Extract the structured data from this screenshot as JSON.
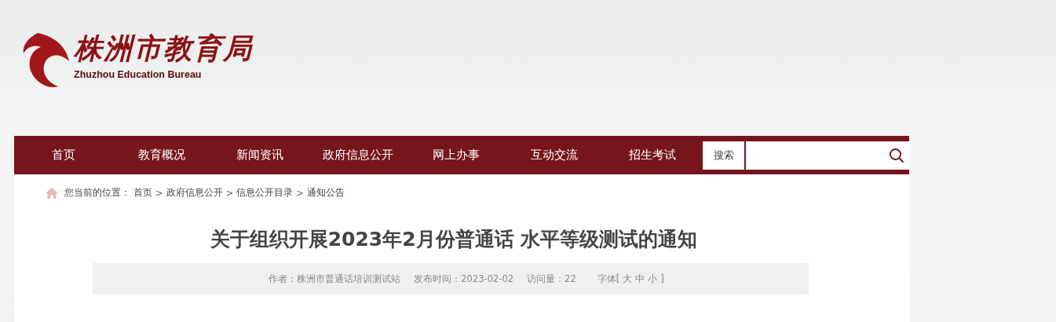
{
  "site": {
    "name": "株洲市教育局",
    "name_en": "Zhuzhou Education Bureau"
  },
  "nav": {
    "items": [
      "首页",
      "教育概况",
      "新闻资讯",
      "政府信息公开",
      "网上办事",
      "互动交流",
      "招生考试"
    ],
    "search_button": "搜索"
  },
  "breadcrumb": {
    "label": "您当前的位置：",
    "separator": ">",
    "items": [
      "首页",
      "政府信息公开",
      "信息公开目录",
      "通知公告"
    ]
  },
  "article": {
    "title": "关于组织开展2023年2月份普通话 水平等级测试的通知",
    "author": "作者：株洲市普通话培训测试站",
    "date": "发布时间：2023-02-02",
    "views": "访问量：22",
    "font_label": "字体[",
    "font_sizes": [
      "大",
      "中",
      "小"
    ],
    "font_close": "]"
  }
}
